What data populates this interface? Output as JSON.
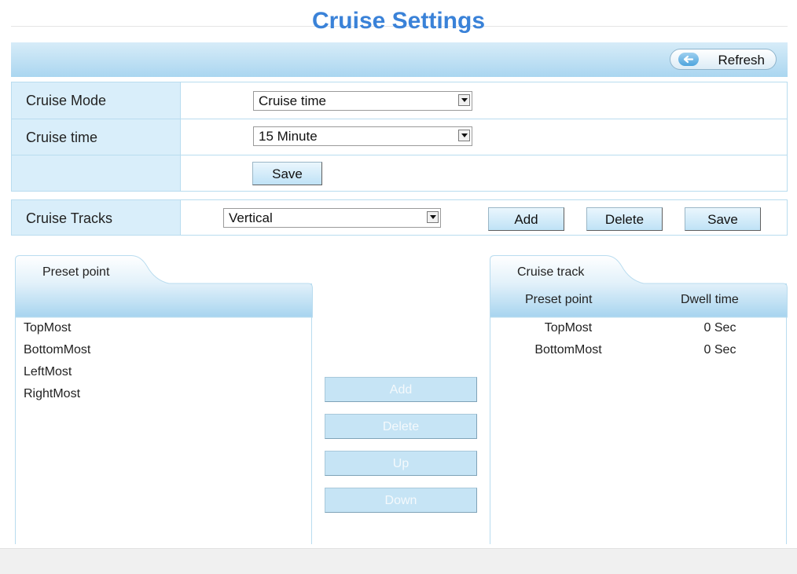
{
  "page": {
    "title": "Cruise Settings"
  },
  "toolbar": {
    "refresh_label": "Refresh"
  },
  "form": {
    "cruise_mode": {
      "label": "Cruise Mode",
      "value": "Cruise time"
    },
    "cruise_time": {
      "label": "Cruise time",
      "value": "15 Minute"
    },
    "save_label": "Save"
  },
  "tracks": {
    "label": "Cruise Tracks",
    "value": "Vertical",
    "add_label": "Add",
    "delete_label": "Delete",
    "save_label": "Save"
  },
  "preset_panel": {
    "tab_label": "Preset point",
    "items": [
      "TopMost",
      "BottomMost",
      "LeftMost",
      "RightMost"
    ]
  },
  "middle_buttons": {
    "add": "Add",
    "delete": "Delete",
    "up": "Up",
    "down": "Down"
  },
  "track_panel": {
    "tab_label": "Cruise track",
    "col_preset": "Preset point",
    "col_dwell": "Dwell time",
    "rows": [
      {
        "preset": "TopMost",
        "dwell": "0 Sec"
      },
      {
        "preset": "BottomMost",
        "dwell": "0 Sec"
      }
    ]
  },
  "colors": {
    "title": "#3a82d8",
    "header_bar": "#aad6f0",
    "label_bg": "#d9eefa",
    "border": "#b9dcef"
  }
}
